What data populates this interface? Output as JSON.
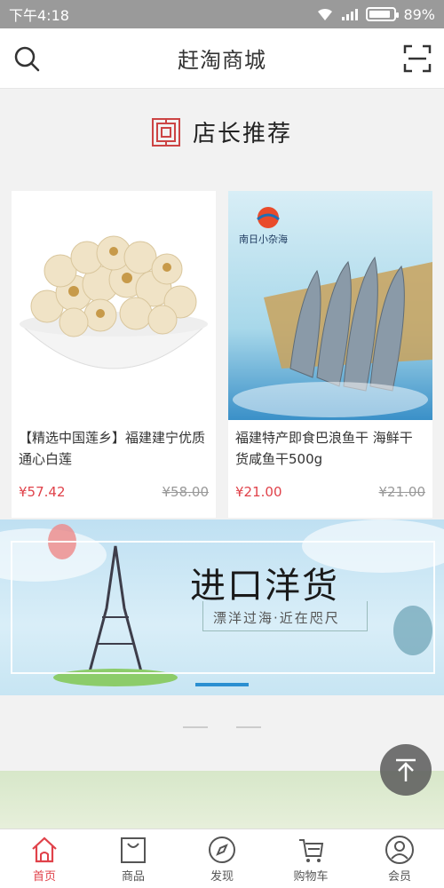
{
  "status_bar": {
    "time": "下午4:18",
    "battery": "89%",
    "battery_level": 0.89
  },
  "header": {
    "title": "赶淘商城"
  },
  "section": {
    "title": "店长推荐"
  },
  "products": [
    {
      "name": "【精选中国莲乡】福建建宁优质通心白莲",
      "price": "¥57.42",
      "original_price": "¥58.00"
    },
    {
      "name": "福建特产即食巴浪鱼干 海鲜干货咸鱼干500g",
      "price": "¥21.00",
      "original_price": "¥21.00",
      "brand": "南日小杂海"
    }
  ],
  "banner": {
    "main_text": "进口洋货",
    "sub_text": "漂洋过海·近在咫尺"
  },
  "tabbar": [
    {
      "label": "首页",
      "icon": "home-icon",
      "active": true
    },
    {
      "label": "商品",
      "icon": "bag-icon",
      "active": false
    },
    {
      "label": "发现",
      "icon": "compass-icon",
      "active": false
    },
    {
      "label": "购物车",
      "icon": "cart-icon",
      "active": false
    },
    {
      "label": "会员",
      "icon": "user-icon",
      "active": false
    }
  ],
  "colors": {
    "accent": "#e0424a",
    "status_bar": "#9a9a9a",
    "banner_indicator": "#2a8fd1"
  }
}
